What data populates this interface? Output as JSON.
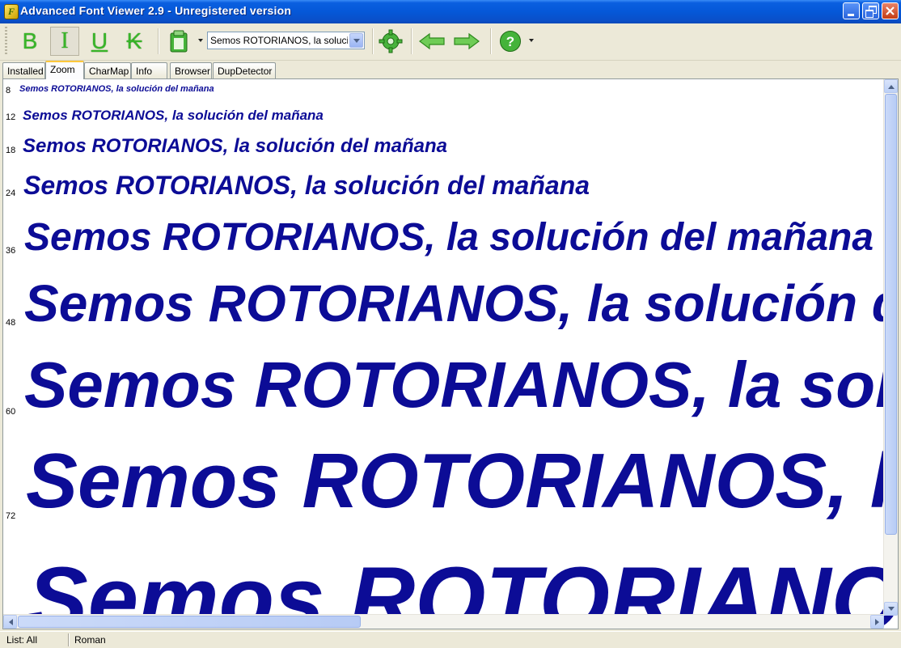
{
  "window": {
    "title": "Advanced Font Viewer 2.9 - Unregistered version",
    "icon": "app-icon"
  },
  "toolbar": {
    "bold_label": "B",
    "italic_label": "I",
    "underline_label": "U",
    "strike_label": "K",
    "sample_text_value": "Semos ROTORIANOS, la solució"
  },
  "tabs": [
    {
      "label": "Installed"
    },
    {
      "label": "Zoom",
      "active": true
    },
    {
      "label": "CharMap"
    },
    {
      "label": "Info"
    },
    {
      "label": "Browser"
    },
    {
      "label": "DupDetector"
    }
  ],
  "preview": {
    "sample_text": "Semos ROTORIANOS, la solución del mañana",
    "text_color": "#0c0c96",
    "sizes": [
      "8",
      "12",
      "18",
      "24",
      "36",
      "48",
      "60",
      "72",
      ""
    ]
  },
  "status": {
    "list": "List: All",
    "style": "Roman"
  }
}
